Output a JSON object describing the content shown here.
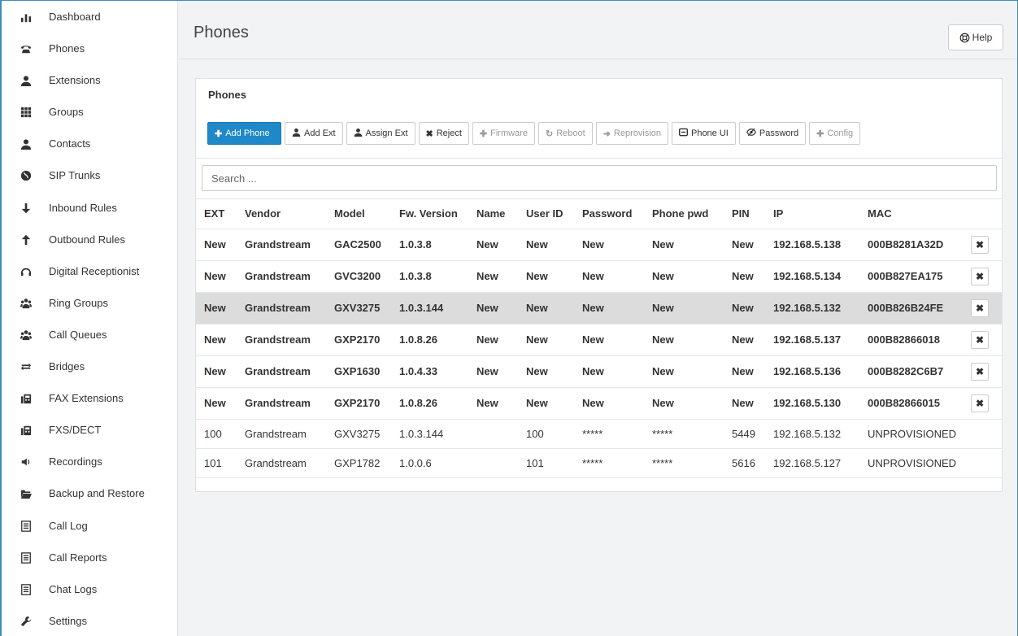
{
  "sidebar": {
    "items": [
      {
        "label": "Dashboard",
        "icon": "bar-chart-icon"
      },
      {
        "label": "Phones",
        "icon": "phone-icon"
      },
      {
        "label": "Extensions",
        "icon": "user-icon"
      },
      {
        "label": "Groups",
        "icon": "grid-icon"
      },
      {
        "label": "Contacts",
        "icon": "user-icon"
      },
      {
        "label": "SIP Trunks",
        "icon": "globe-icon"
      },
      {
        "label": "Inbound Rules",
        "icon": "arrow-down-icon"
      },
      {
        "label": "Outbound Rules",
        "icon": "arrow-up-icon"
      },
      {
        "label": "Digital Receptionist",
        "icon": "headset-icon"
      },
      {
        "label": "Ring Groups",
        "icon": "users-icon"
      },
      {
        "label": "Call Queues",
        "icon": "users-icon"
      },
      {
        "label": "Bridges",
        "icon": "exchange-icon"
      },
      {
        "label": "FAX Extensions",
        "icon": "fax-icon"
      },
      {
        "label": "FXS/DECT",
        "icon": "fax-icon"
      },
      {
        "label": "Recordings",
        "icon": "volume-icon"
      },
      {
        "label": "Backup and Restore",
        "icon": "folder-open-icon"
      },
      {
        "label": "Call Log",
        "icon": "list-icon"
      },
      {
        "label": "Call Reports",
        "icon": "list-icon"
      },
      {
        "label": "Chat Logs",
        "icon": "list-icon"
      },
      {
        "label": "Settings",
        "icon": "wrench-icon"
      }
    ]
  },
  "header": {
    "title": "Phones",
    "help_label": "Help"
  },
  "panel": {
    "title": "Phones",
    "toolbar": {
      "add_phone": "Add Phone",
      "add_ext": "Add Ext",
      "assign_ext": "Assign Ext",
      "reject": "Reject",
      "firmware": "Firmware",
      "reboot": "Reboot",
      "reprovision": "Reprovision",
      "phone_ui": "Phone UI",
      "password": "Password",
      "config": "Config"
    },
    "search": {
      "placeholder": "Search ...",
      "value": ""
    },
    "columns": [
      "EXT",
      "Vendor",
      "Model",
      "Fw. Version",
      "Name",
      "User ID",
      "Password",
      "Phone pwd",
      "PIN",
      "IP",
      "MAC"
    ],
    "rows": [
      {
        "cells": [
          "New",
          "Grandstream",
          "GAC2500",
          "1.0.3.8",
          "New",
          "New",
          "New",
          "New",
          "New",
          "192.168.5.138",
          "000B8281A32D"
        ],
        "is_new": true,
        "highlight": false
      },
      {
        "cells": [
          "New",
          "Grandstream",
          "GVC3200",
          "1.0.3.8",
          "New",
          "New",
          "New",
          "New",
          "New",
          "192.168.5.134",
          "000B827EA175"
        ],
        "is_new": true,
        "highlight": false
      },
      {
        "cells": [
          "New",
          "Grandstream",
          "GXV3275",
          "1.0.3.144",
          "New",
          "New",
          "New",
          "New",
          "New",
          "192.168.5.132",
          "000B826B24FE"
        ],
        "is_new": true,
        "highlight": true
      },
      {
        "cells": [
          "New",
          "Grandstream",
          "GXP2170",
          "1.0.8.26",
          "New",
          "New",
          "New",
          "New",
          "New",
          "192.168.5.137",
          "000B82866018"
        ],
        "is_new": true,
        "highlight": false
      },
      {
        "cells": [
          "New",
          "Grandstream",
          "GXP1630",
          "1.0.4.33",
          "New",
          "New",
          "New",
          "New",
          "New",
          "192.168.5.136",
          "000B8282C6B7"
        ],
        "is_new": true,
        "highlight": false
      },
      {
        "cells": [
          "New",
          "Grandstream",
          "GXP2170",
          "1.0.8.26",
          "New",
          "New",
          "New",
          "New",
          "New",
          "192.168.5.130",
          "000B82866015"
        ],
        "is_new": true,
        "highlight": false
      },
      {
        "cells": [
          "100",
          "Grandstream",
          "GXV3275",
          "1.0.3.144",
          "",
          "100",
          "*****",
          "*****",
          "5449",
          "192.168.5.132",
          "UNPROVISIONED"
        ],
        "is_new": false,
        "highlight": false
      },
      {
        "cells": [
          "101",
          "Grandstream",
          "GXP1782",
          "1.0.0.6",
          "",
          "101",
          "*****",
          "*****",
          "5616",
          "192.168.5.127",
          "UNPROVISIONED"
        ],
        "is_new": false,
        "highlight": false
      }
    ],
    "delete_glyph": "✖"
  }
}
